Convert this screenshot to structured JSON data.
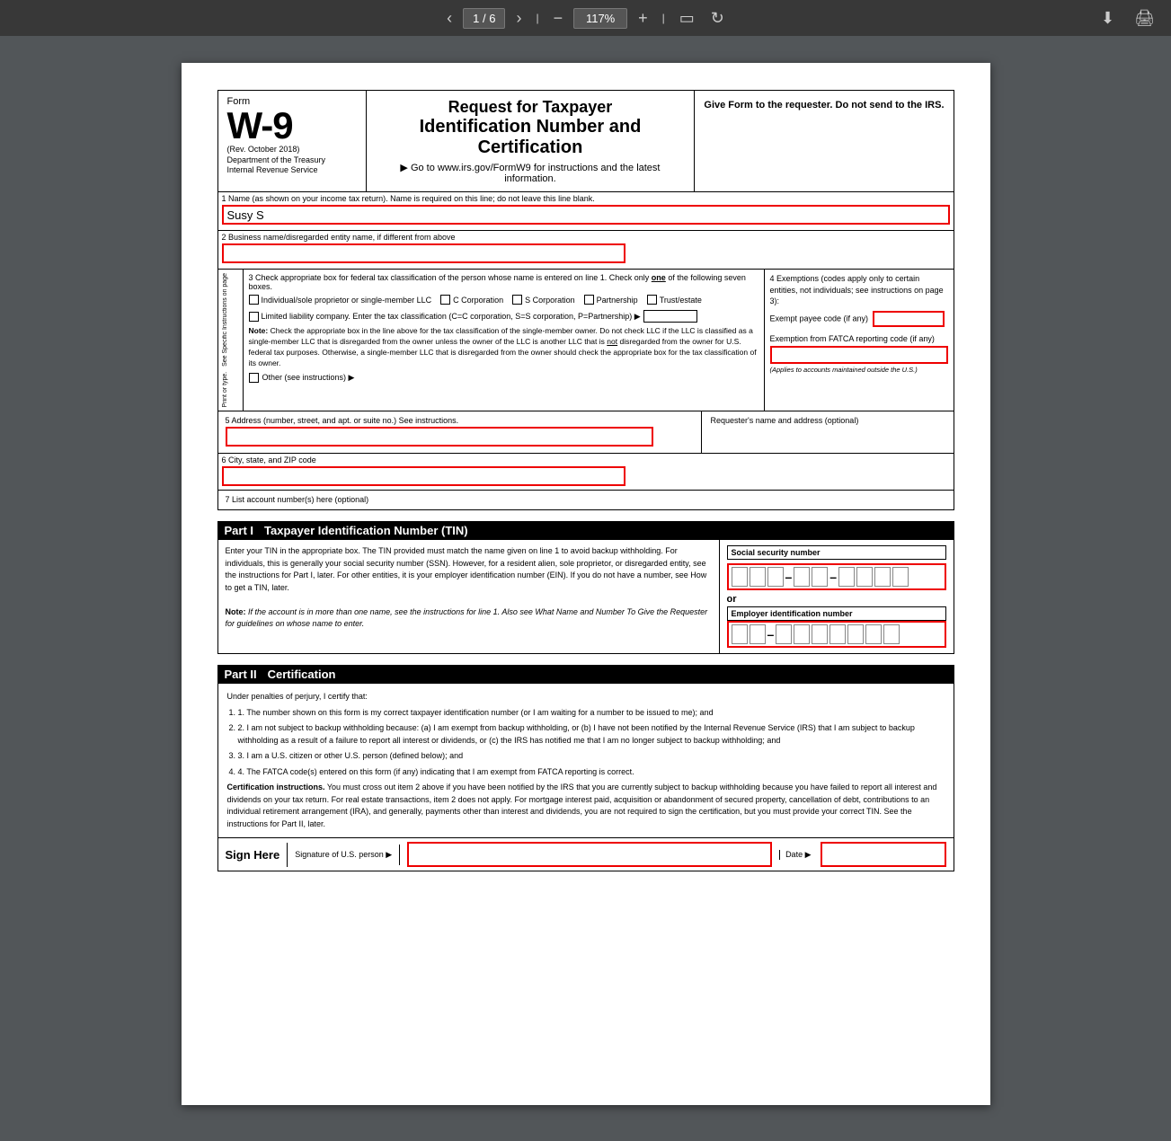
{
  "toolbar": {
    "page_current": "1",
    "page_total": "6",
    "zoom": "117%",
    "download_icon": "⬇",
    "print_icon": "🖨"
  },
  "form": {
    "form_label": "Form",
    "form_number": "W-9",
    "rev_date": "(Rev. October 2018)",
    "dept": "Department of the Treasury",
    "irs": "Internal Revenue Service",
    "title_line1": "Request for Taxpayer",
    "title_line2": "Identification Number and Certification",
    "url_text": "▶ Go to www.irs.gov/FormW9 for instructions and the latest information.",
    "give_form_text": "Give Form to the requester. Do not send to the IRS.",
    "line1_label": "1  Name (as shown on your income tax return). Name is required on this line; do not leave this line blank.",
    "line1_value": "Susy S",
    "line2_label": "2  Business name/disregarded entity name, if different from above",
    "line3_label": "3  Check appropriate box for federal tax classification of the person whose name is entered on line 1. Check only",
    "line3_label2": "one",
    "line3_label3": "of the following seven boxes.",
    "check_only_text": "Check only",
    "individual_label": "Individual/sole proprietor or single-member LLC",
    "c_corp_label": "C Corporation",
    "s_corp_label": "S Corporation",
    "partnership_label": "Partnership",
    "trust_label": "Trust/estate",
    "llc_label": "Limited liability company. Enter the tax classification (C=C corporation, S=S corporation, P=Partnership) ▶",
    "note_label": "Note:",
    "note_text": "Check the appropriate box in the line above for the tax classification of the single-member owner. Do not check LLC if the LLC is classified as a single-member LLC that is disregarded from the owner unless the owner of the LLC is another LLC that is",
    "note_not": "not",
    "note_text2": "disregarded from the owner for U.S. federal tax purposes. Otherwise, a single-member LLC that is disregarded from the owner should check the appropriate box for the tax classification of its owner.",
    "do_not_check": "Do not check",
    "other_label": "Other (see instructions) ▶",
    "line4_label": "4  Exemptions (codes apply only to certain entities, not individuals; see instructions on page 3):",
    "exempt_payee_label": "Exempt payee code (if any)",
    "fatca_label": "Exemption from FATCA reporting code (if any)",
    "fatca_note": "(Applies to accounts maintained outside the U.S.)",
    "line5_label": "5  Address (number, street, and apt. or suite no.) See instructions.",
    "requester_label": "Requester's name and address (optional)",
    "line6_label": "6  City, state, and ZIP code",
    "line7_label": "7  List account number(s) here (optional)",
    "sidebar_text": "See Specific Instructions on page",
    "sidebar_text2": "Print or type.",
    "part1_number": "Part I",
    "part1_title": "Taxpayer Identification Number (TIN)",
    "tin_instructions": "Enter your TIN in the appropriate box. The TIN provided must match the name given on line 1 to avoid backup withholding. For individuals, this is generally your social security number (SSN). However, for a resident alien, sole proprietor, or disregarded entity, see the instructions for Part I, later. For other entities, it is your employer identification number (EIN). If you do not have a number, see How to get a TIN, later.",
    "tin_note_label": "Note:",
    "tin_note_text": "If the account is in more than one name, see the instructions for line 1. Also see What Name and Number To Give the Requester for guidelines on whose name to enter.",
    "ssn_label": "Social security number",
    "or_text": "or",
    "ein_label": "Employer identification number",
    "part2_number": "Part II",
    "part2_title": "Certification",
    "cert_under": "Under penalties of perjury, I certify that:",
    "cert_1": "1. The number shown on this form is my correct taxpayer identification number (or I am waiting for a number to be issued to me); and",
    "cert_2": "2. I am not subject to backup withholding because: (a) I am exempt from backup withholding, or (b) I have not been notified by the Internal Revenue Service (IRS) that I am subject to backup withholding as a result of a failure to report all interest or dividends, or (c) the IRS has notified me that I am no longer subject to backup withholding; and",
    "cert_3": "3. I am a U.S. citizen or other U.S. person (defined below); and",
    "cert_4": "4. The FATCA code(s) entered on this form (if any) indicating that I am exempt from FATCA reporting is correct.",
    "cert_inst_label": "Certification instructions.",
    "cert_inst_text": "You must cross out item 2 above if you have been notified by the IRS that you are currently subject to backup withholding because you have failed to report all interest and dividends on your tax return. For real estate transactions, item 2 does not apply. For mortgage interest paid, acquisition or abandonment of secured property, cancellation of debt, contributions to an individual retirement arrangement (IRA), and generally, payments other than interest and dividends, you are not required to sign the certification, but you must provide your correct TIN. See the instructions for Part II, later.",
    "sign_here_label": "Sign Here",
    "signature_label": "Signature of U.S. person ▶",
    "date_label": "Date ▶"
  }
}
